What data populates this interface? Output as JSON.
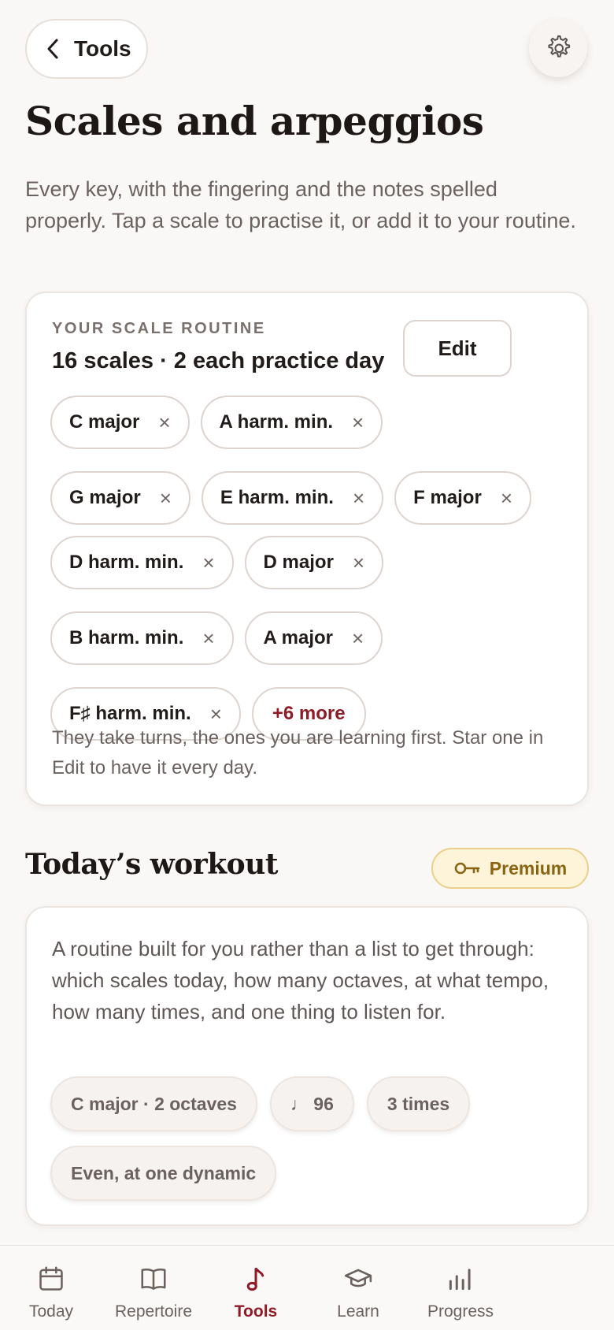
{
  "header": {
    "back_label": "Tools",
    "title": "Scales and arpeggios",
    "intro": "Every key, with the fingering and the notes spelled properly. Tap a scale to practise it, or add it to your routine."
  },
  "routine": {
    "eyebrow": "YOUR SCALE ROUTINE",
    "summary": "16 scales · 2 each practice day",
    "edit_label": "Edit",
    "remove_glyph": "×",
    "scales": [
      "C major",
      "A harm. min.",
      "G major",
      "E harm. min.",
      "F major",
      "D harm. min.",
      "D major",
      "B harm. min.",
      "A major",
      "F♯ harm. min."
    ],
    "more_label": "+6 more",
    "note": "They take turns, the ones you are learning first. Star one in Edit to have it every day."
  },
  "workout": {
    "title": "Today’s workout",
    "premium_label": "Premium",
    "description": "A routine built for you rather than a list to get through: which scales today, how many octaves, at what tempo, how many times, and one thing to listen for.",
    "chips": [
      "C major · 2 octaves",
      "♩ 96",
      "3 times",
      "Even, at one dynamic"
    ]
  },
  "nav": {
    "items": [
      {
        "label": "Today",
        "icon": "calendar-icon"
      },
      {
        "label": "Repertoire",
        "icon": "open-book-icon"
      },
      {
        "label": "Tools",
        "icon": "music-note-icon"
      },
      {
        "label": "Learn",
        "icon": "graduation-cap-icon"
      },
      {
        "label": "Progress",
        "icon": "bar-chart-icon"
      }
    ],
    "active": "Tools"
  },
  "colors": {
    "accent": "#8e1b26",
    "premium": "#8a6410",
    "background": "#faf8f6"
  }
}
